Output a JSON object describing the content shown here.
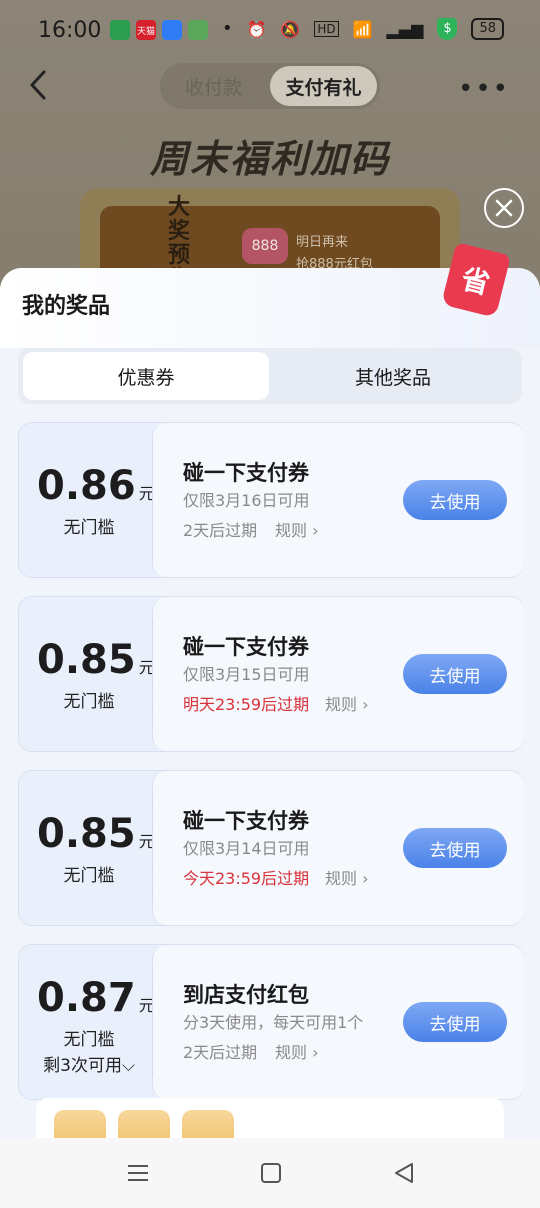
{
  "status": {
    "time": "16:00",
    "battery": "58",
    "app_icons": [
      {
        "name": "shield-app-icon",
        "color": "#2a9d4f",
        "label": ""
      },
      {
        "name": "tmall-app-icon",
        "color": "#d6202c",
        "label": "天猫"
      },
      {
        "name": "play-app-icon",
        "color": "#2f7cf6",
        "label": ""
      },
      {
        "name": "anjuke-app-icon",
        "color": "#5aa65a",
        "label": ""
      }
    ]
  },
  "topnav": {
    "tabs": [
      "收付款",
      "支付有礼"
    ],
    "active_tab": "支付有礼"
  },
  "banner": {
    "title": "周末福利加码",
    "prize_label": "大奖预告",
    "prize_amount": "888",
    "prize_text_1": "明日再来",
    "prize_text_2": "抢888元红包"
  },
  "sheet": {
    "title": "我的奖品",
    "save_tag": "省",
    "tabs": [
      "优惠券",
      "其他奖品"
    ],
    "coupons": [
      {
        "amount": "0.86",
        "unit": "元",
        "threshold": "无门槛",
        "remain": "",
        "title": "碰一下支付券",
        "validity": "仅限3月16日可用",
        "expiry": "2天后过期",
        "expiry_urgent": false,
        "rule": "规则 ›",
        "button": "去使用"
      },
      {
        "amount": "0.85",
        "unit": "元",
        "threshold": "无门槛",
        "remain": "",
        "title": "碰一下支付券",
        "validity": "仅限3月15日可用",
        "expiry": "明天23:59后过期",
        "expiry_urgent": true,
        "rule": "规则 ›",
        "button": "去使用"
      },
      {
        "amount": "0.85",
        "unit": "元",
        "threshold": "无门槛",
        "remain": "",
        "title": "碰一下支付券",
        "validity": "仅限3月14日可用",
        "expiry": "今天23:59后过期",
        "expiry_urgent": true,
        "rule": "规则 ›",
        "button": "去使用"
      },
      {
        "amount": "0.87",
        "unit": "元",
        "threshold": "无门槛",
        "remain": "剩3次可用⌵",
        "title": "到店支付红包",
        "validity": "分3天使用，每天可用1个",
        "expiry": "2天后过期",
        "expiry_urgent": false,
        "rule": "规则 ›",
        "button": "去使用"
      }
    ]
  },
  "colors": {
    "accent_blue": "#4a82e8",
    "urgent_red": "#d8323a",
    "save_tag_red": "#e93a4f"
  }
}
